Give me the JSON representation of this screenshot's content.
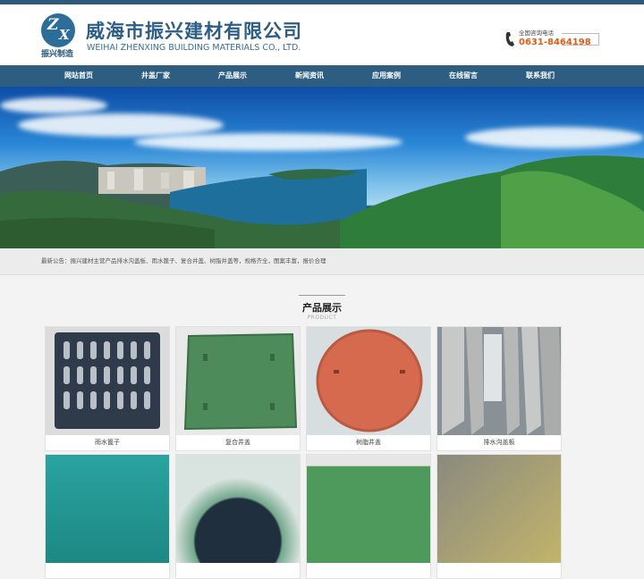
{
  "header": {
    "cn_name": "威海市振兴建材有限公司",
    "en_name": "WEIHAI ZHENXING BUILDING MATERIALS CO., LTD.",
    "logo_sub": "振兴制造",
    "logo_letters": [
      "Z",
      "X"
    ],
    "hotline_label": "全国咨询电话",
    "hotline_number": "0631-8464198"
  },
  "nav": {
    "items": [
      {
        "label": "网站首页"
      },
      {
        "label": "井盖厂家"
      },
      {
        "label": "产品展示"
      },
      {
        "label": "新闻资讯"
      },
      {
        "label": "应用案例"
      },
      {
        "label": "在线留言"
      },
      {
        "label": "联系我们"
      }
    ]
  },
  "notice": {
    "text": "最新公告：振兴建材主营产品排水沟盖板、雨水篦子、复合井盖、树脂井盖等，规格齐全，图案丰富，报价合理"
  },
  "products": {
    "title_cn": "产品展示",
    "title_en": "PRODUCT",
    "items": [
      {
        "caption": "雨水篦子"
      },
      {
        "caption": "复合井盖"
      },
      {
        "caption": "树脂井盖"
      },
      {
        "caption": "排水沟盖板"
      },
      {
        "caption": ""
      },
      {
        "caption": ""
      },
      {
        "caption": ""
      },
      {
        "caption": ""
      }
    ]
  },
  "colors": {
    "nav_bg": "#2d5d80",
    "brand": "#2c5d86",
    "hotline": "#e05b15"
  }
}
